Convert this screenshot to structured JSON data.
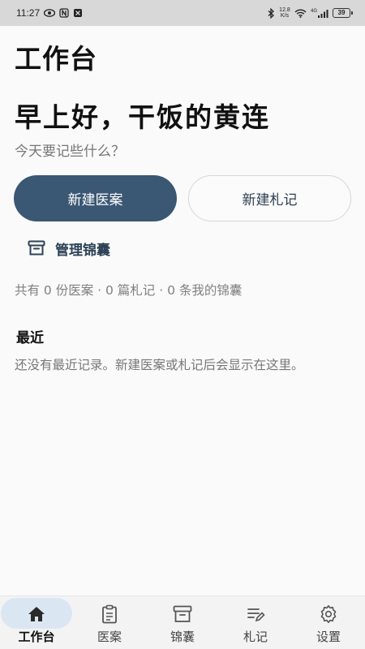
{
  "status_bar": {
    "time": "11:27",
    "net_speed_top": "12.8",
    "net_speed_bottom": "K/s",
    "signal_type": "4G",
    "battery": "39"
  },
  "header": {
    "title": "工作台"
  },
  "greeting": {
    "headline": "早上好，干饭的黄连",
    "subtitle": "今天要记些什么？"
  },
  "actions": {
    "new_case_label": "新建医案",
    "new_note_label": "新建札记",
    "manage_label": "管理锦囊",
    "manage_icon": "archive-icon"
  },
  "stats": {
    "text": "共有 0 份医案 · 0 篇札记 · 0 条我的锦囊"
  },
  "recent": {
    "title": "最近",
    "empty_text": "还没有最近记录。新建医案或札记后会显示在这里。"
  },
  "bottom_nav": {
    "items": [
      {
        "label": "工作台",
        "icon": "home-icon",
        "active": true
      },
      {
        "label": "医案",
        "icon": "clipboard-icon",
        "active": false
      },
      {
        "label": "锦囊",
        "icon": "archive-icon",
        "active": false
      },
      {
        "label": "札记",
        "icon": "note-edit-icon",
        "active": false
      },
      {
        "label": "设置",
        "icon": "gear-icon",
        "active": false
      }
    ]
  },
  "colors": {
    "primary": "#3a5773",
    "nav_active_bg": "#dbe6f3",
    "background": "#fafafa"
  }
}
